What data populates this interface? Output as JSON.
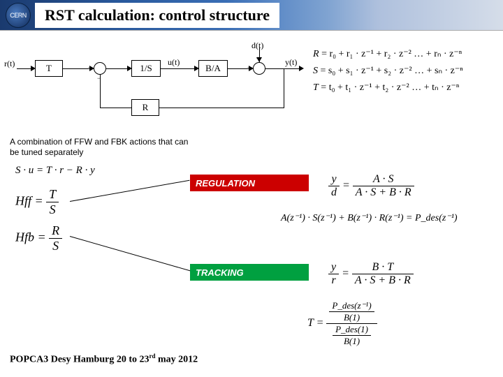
{
  "header": {
    "logo_text": "CERN",
    "title": "RST calculation: control structure"
  },
  "diagram": {
    "signals": {
      "r": "r(t)",
      "d": "d(t)",
      "u": "u(t)",
      "y": "y(t)"
    },
    "blocks": {
      "T": "T",
      "oneOverS": "1/S",
      "BA": "B/A",
      "R": "R"
    }
  },
  "caption": "A combination of FFW and FBK actions that can be tuned separately",
  "defs": {
    "R_lhs": "R",
    "R_rhs": "= r₀ + r₁ · z⁻¹ + r₂ · z⁻² … + rₙ · z⁻ⁿ",
    "S_lhs": "S",
    "S_rhs": "= s₀ + s₁ · z⁻¹ + s₂ · z⁻² … + sₙ · z⁻ⁿ",
    "T_lhs": "T",
    "T_rhs": "= t₀ + t₁ · z⁻¹ + t₂ · z⁻² … + tₙ · z⁻ⁿ"
  },
  "eqs": {
    "su": "S · u = T · r − R · y",
    "hff_lhs": "Hff =",
    "hff_num": "T",
    "hff_den": "S",
    "hfb_lhs": "Hfb =",
    "hfb_num": "R",
    "hfb_den": "S",
    "yd_lhs_num": "y",
    "yd_lhs_den": "d",
    "yd_rhs_num": "A · S",
    "yd_rhs_den": "A · S + B · R",
    "as_eq": "A(z⁻¹) · S(z⁻¹) + B(z⁻¹) · R(z⁻¹) = P_des(z⁻¹)",
    "yr_lhs_num": "y",
    "yr_lhs_den": "r",
    "yr_rhs_num": "B · T",
    "yr_rhs_den": "A · S + B · R",
    "T_lhs": "T =",
    "T_outer_num_num": "P_des(z⁻¹)",
    "T_outer_num_den": "B(1)",
    "T_outer_den_num": "P_des(1)",
    "T_outer_den_den": "B(1)"
  },
  "labels": {
    "regulation": "REGULATION",
    "tracking": "TRACKING"
  },
  "footer": {
    "text_pre": "POPCA3 Desy Hamburg 20 to 23",
    "sup": "rd",
    "text_post": " may 2012"
  }
}
